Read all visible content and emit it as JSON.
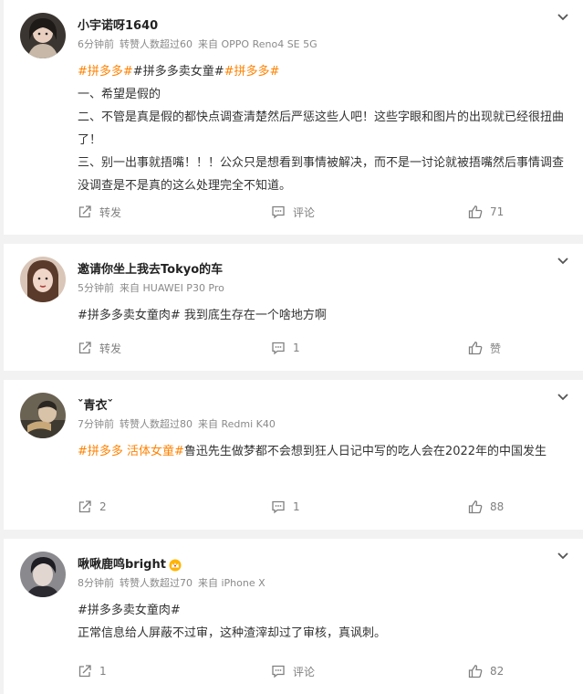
{
  "posts": [
    {
      "user": "小宇诺呀1640",
      "time": "6分钟前",
      "reposts_note": "转赞人数超过60",
      "source": "来自 OPPO Reno4 SE 5G",
      "segments": [
        {
          "text": "#拼多多#",
          "tag": true
        },
        {
          "text": "#拼多多卖女童#",
          "tag": false
        },
        {
          "text": "#拼多多#",
          "tag": true
        }
      ],
      "lines": [
        "一、希望是假的",
        "二、不管是真是假的都快点调查清楚然后严惩这些人吧！这些字眼和图片的出现就已经很扭曲了！",
        "三、别一出事就捂嘴！！！公众只是想看到事情被解决，而不是一讨论就被捂嘴然后事情调查没调查是不是真的这么处理完全不知道。"
      ],
      "share": "转发",
      "comment": "评论",
      "like": "71"
    },
    {
      "user": "邀请你坐上我去Tokyo的车",
      "time": "5分钟前",
      "reposts_note": "",
      "source": "来自 HUAWEI P30 Pro",
      "segments": [
        {
          "text": "#拼多多卖女童肉# 我到底生存在一个啥地方啊",
          "tag": false
        }
      ],
      "lines": [],
      "share": "转发",
      "comment": "1",
      "like": "赞"
    },
    {
      "user": "ˇ青衣ˇ",
      "time": "7分钟前",
      "reposts_note": "转赞人数超过80",
      "source": "来自 Redmi K40",
      "segments": [
        {
          "text": "#拼多多 活体女童#",
          "tag": true
        },
        {
          "text": "鲁迅先生做梦都不会想到狂人日记中写的吃人会在2022年的中国发生",
          "tag": false
        }
      ],
      "lines": [],
      "share": "2",
      "comment": "1",
      "like": "88"
    },
    {
      "user": "啾啾鹿鸣bright",
      "time": "8分钟前",
      "reposts_note": "转赞人数超过70",
      "source": "来自 iPhone X",
      "segments": [
        {
          "text": "#拼多多卖女童肉#",
          "tag": false
        }
      ],
      "lines": [
        "正常信息给人屏蔽不过审，这种渣滓却过了审核，真讽刺。"
      ],
      "share": "1",
      "comment": "评论",
      "like": "82"
    }
  ],
  "icons": {
    "share": "share-icon",
    "comment": "comment-icon",
    "like": "thumbs-up-icon",
    "more": "chevron-down-icon",
    "badge": "crown-badge-icon"
  },
  "colors": {
    "tag": "#ff8200",
    "background": "#f2f2f2",
    "meta": "#8a8a8a"
  }
}
